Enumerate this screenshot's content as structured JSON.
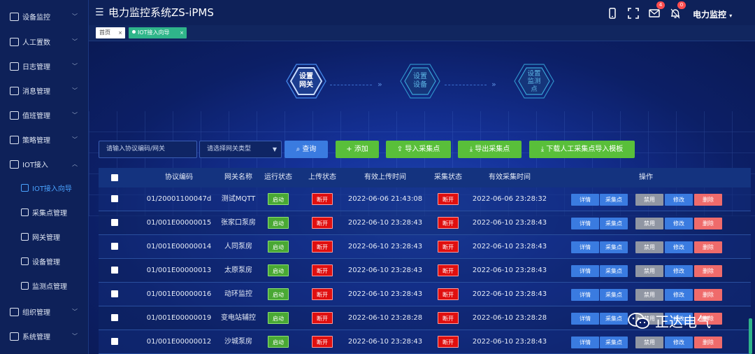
{
  "app": {
    "title": "电力监控系统ZS-iPMS",
    "menu_glyph": "☰",
    "user": "电力监控"
  },
  "topbar": {
    "mail_badge": "4",
    "alert_badge": "0"
  },
  "sidebar": {
    "items": [
      {
        "label": "设备监控",
        "icon": "dashboard-icon"
      },
      {
        "label": "人工置数",
        "icon": "form-icon"
      },
      {
        "label": "日志管理",
        "icon": "log-icon"
      },
      {
        "label": "消息管理",
        "icon": "message-icon"
      },
      {
        "label": "值班管理",
        "icon": "duty-icon"
      },
      {
        "label": "策略管理",
        "icon": "strategy-icon"
      },
      {
        "label": "IOT接入",
        "icon": "iot-icon"
      }
    ],
    "subitems": [
      {
        "label": "IOT接入向导",
        "icon": "wizard-icon",
        "active": true
      },
      {
        "label": "采集点管理",
        "icon": "point-icon"
      },
      {
        "label": "网关管理",
        "icon": "gateway-icon"
      },
      {
        "label": "设备管理",
        "icon": "device-icon"
      },
      {
        "label": "监测点管理",
        "icon": "monitor-icon"
      }
    ],
    "bottom_items": [
      {
        "label": "组织管理",
        "icon": "org-icon"
      },
      {
        "label": "系统管理",
        "icon": "system-icon"
      }
    ]
  },
  "tabs": {
    "home": "首页",
    "active": "IOT接入向导",
    "close_glyph": "×"
  },
  "steps": {
    "step1": "设置\n网关",
    "step2": "设置\n设备",
    "step3": "设置\n监测\n点",
    "arrow": "»"
  },
  "filters": {
    "protocol_placeholder": "请输入协议编码/网关",
    "gateway_type_placeholder": "请选择网关类型",
    "query": "查询",
    "add": "添加",
    "import_points": "导入采集点",
    "export_points": "导出采集点",
    "download_template": "下载人工采集点导入模板"
  },
  "table": {
    "headers": [
      "协议编码",
      "网关名称",
      "运行状态",
      "上传状态",
      "有效上传时间",
      "采集状态",
      "有效采集时间",
      "操作"
    ],
    "actions": [
      "详情",
      "采集点",
      "禁用",
      "修改",
      "删除"
    ],
    "rows": [
      {
        "code": "01/20001100047d",
        "name": "测试MQTT",
        "run": "启动",
        "upload": "断开",
        "upload_time": "2022-06-06 21:43:08",
        "collect": "断开",
        "collect_time": "2022-06-06 23:28:32"
      },
      {
        "code": "01/001E00000015",
        "name": "张家口泵房",
        "run": "启动",
        "upload": "断开",
        "upload_time": "2022-06-10 23:28:43",
        "collect": "断开",
        "collect_time": "2022-06-10 23:28:43"
      },
      {
        "code": "01/001E00000014",
        "name": "人同泵房",
        "run": "启动",
        "upload": "断开",
        "upload_time": "2022-06-10 23:28:43",
        "collect": "断开",
        "collect_time": "2022-06-10 23:28:43"
      },
      {
        "code": "01/001E00000013",
        "name": "太原泵房",
        "run": "启动",
        "upload": "断开",
        "upload_time": "2022-06-10 23:28:43",
        "collect": "断开",
        "collect_time": "2022-06-10 23:28:43"
      },
      {
        "code": "01/001E00000016",
        "name": "动环监控",
        "run": "启动",
        "upload": "断开",
        "upload_time": "2022-06-10 23:28:43",
        "collect": "断开",
        "collect_time": "2022-06-10 23:28:43"
      },
      {
        "code": "01/001E00000019",
        "name": "变电站辅控",
        "run": "启动",
        "upload": "断开",
        "upload_time": "2022-06-10 23:28:28",
        "collect": "断开",
        "collect_time": "2022-06-10 23:28:28"
      },
      {
        "code": "01/001E00000012",
        "name": "沙城泵房",
        "run": "启动",
        "upload": "断开",
        "upload_time": "2022-06-10 23:28:43",
        "collect": "断开",
        "collect_time": "2022-06-10 23:28:43"
      }
    ]
  },
  "watermark": {
    "text": "正达电气"
  },
  "colors": {
    "primary_blue": "#3a7be0",
    "success_green": "#59bf3a",
    "danger_red": "#e00f0f",
    "tab_green": "#2fb58a"
  }
}
